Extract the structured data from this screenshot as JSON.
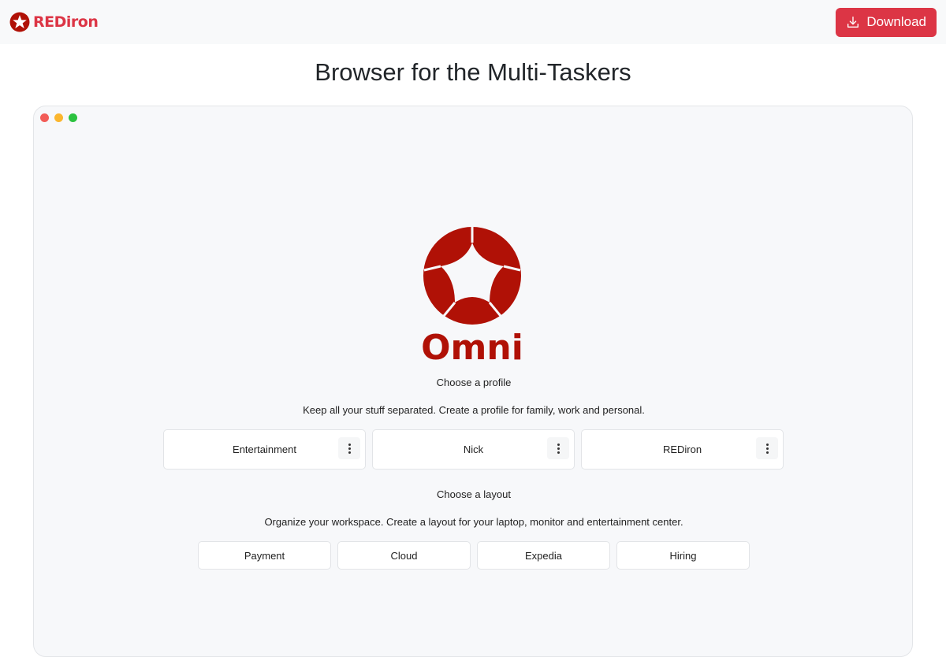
{
  "navbar": {
    "brand_name": "REDiron",
    "download_label": "Download"
  },
  "page": {
    "title": "Browser for the Multi-Taskers"
  },
  "colors": {
    "brand_red": "#dc3545",
    "logo_red": "#b01106",
    "window_bg": "#f7f8fa"
  },
  "window": {
    "traffic_lights": [
      "close",
      "minimize",
      "maximize"
    ],
    "logo_text": "Omni",
    "profile_section": {
      "title": "Choose a profile",
      "description": "Keep all your stuff separated. Create a profile for family, work and personal.",
      "profiles": [
        {
          "name": "Entertainment"
        },
        {
          "name": "Nick"
        },
        {
          "name": "REDiron"
        }
      ]
    },
    "layout_section": {
      "title": "Choose a layout",
      "description": "Organize your workspace. Create a layout for your laptop, monitor and entertainment center.",
      "layouts": [
        {
          "name": "Payment"
        },
        {
          "name": "Cloud"
        },
        {
          "name": "Expedia"
        },
        {
          "name": "Hiring"
        }
      ]
    }
  }
}
